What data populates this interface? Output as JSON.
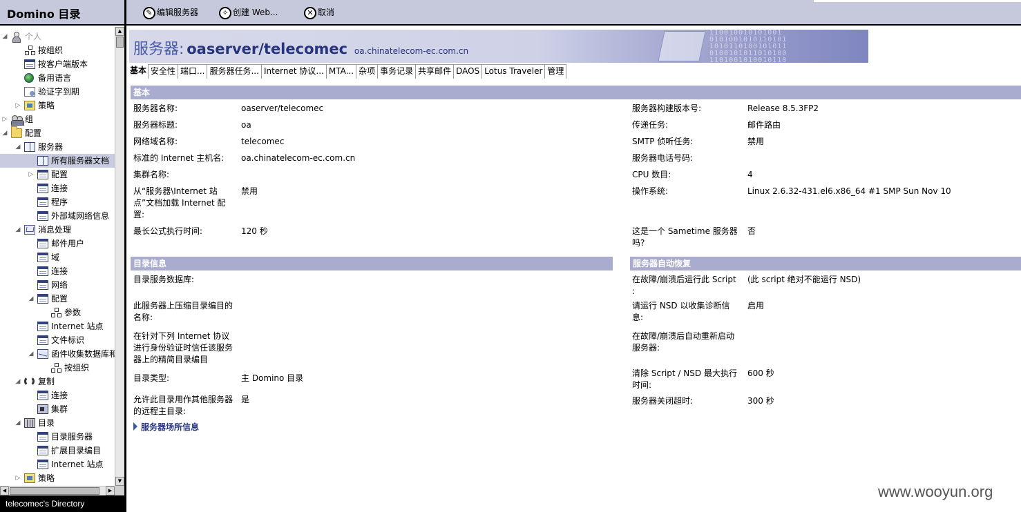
{
  "left_pane": {
    "title": "Domino 目录",
    "status": "telecomec's Directory"
  },
  "tree": [
    {
      "label": "个人",
      "icon": "person-icon",
      "level": 0,
      "twisty": "open",
      "muted": true
    },
    {
      "label": "按组织",
      "icon": "org-tree-icon",
      "level": 1,
      "twisty": "none"
    },
    {
      "label": "按客户端版本",
      "icon": "document-view-icon",
      "level": 1,
      "twisty": "none"
    },
    {
      "label": "备用语言",
      "icon": "globe-icon",
      "level": 1,
      "twisty": "none"
    },
    {
      "label": "验证字到期",
      "icon": "certificate-icon",
      "level": 1,
      "twisty": "none"
    },
    {
      "label": "策略",
      "icon": "policy-icon",
      "level": 1,
      "twisty": "closed"
    },
    {
      "label": "组",
      "icon": "group-icon",
      "level": 0,
      "twisty": "closed"
    },
    {
      "label": "配置",
      "icon": "folder-icon",
      "level": 0,
      "twisty": "open"
    },
    {
      "label": "服务器",
      "icon": "book-icon",
      "level": 1,
      "twisty": "open"
    },
    {
      "label": "所有服务器文档",
      "icon": "book-icon",
      "level": 2,
      "twisty": "none",
      "selected": true
    },
    {
      "label": "配置",
      "icon": "document-view-icon",
      "level": 2,
      "twisty": "closed"
    },
    {
      "label": "连接",
      "icon": "document-view-icon",
      "level": 2,
      "twisty": "none"
    },
    {
      "label": "程序",
      "icon": "document-view-icon",
      "level": 2,
      "twisty": "none"
    },
    {
      "label": "外部域网络信息",
      "icon": "document-view-icon",
      "level": 2,
      "twisty": "none"
    },
    {
      "label": "消息处理",
      "icon": "messaging-icon",
      "level": 1,
      "twisty": "open"
    },
    {
      "label": "邮件用户",
      "icon": "document-view-icon",
      "level": 2,
      "twisty": "none"
    },
    {
      "label": "域",
      "icon": "document-view-icon",
      "level": 2,
      "twisty": "none"
    },
    {
      "label": "连接",
      "icon": "document-view-icon",
      "level": 2,
      "twisty": "none"
    },
    {
      "label": "网络",
      "icon": "document-view-icon",
      "level": 2,
      "twisty": "none"
    },
    {
      "label": "配置",
      "icon": "document-view-icon",
      "level": 2,
      "twisty": "open"
    },
    {
      "label": "参数",
      "icon": "org-tree-icon",
      "level": 3,
      "twisty": "none"
    },
    {
      "label": "Internet 站点",
      "icon": "document-view-icon",
      "level": 2,
      "twisty": "none"
    },
    {
      "label": "文件标识",
      "icon": "document-view-icon",
      "level": 2,
      "twisty": "none"
    },
    {
      "label": "函件收集数据库和",
      "icon": "mail-icon",
      "level": 2,
      "twisty": "open"
    },
    {
      "label": "按组织",
      "icon": "org-tree-icon",
      "level": 3,
      "twisty": "none"
    },
    {
      "label": "复制",
      "icon": "sync-icon",
      "level": 1,
      "twisty": "open"
    },
    {
      "label": "连接",
      "icon": "document-view-icon",
      "level": 2,
      "twisty": "none"
    },
    {
      "label": "集群",
      "icon": "cluster-icon",
      "level": 2,
      "twisty": "none"
    },
    {
      "label": "目录",
      "icon": "directory-icon",
      "level": 1,
      "twisty": "open"
    },
    {
      "label": "目录服务器",
      "icon": "document-view-icon",
      "level": 2,
      "twisty": "none"
    },
    {
      "label": "扩展目录编目",
      "icon": "document-view-icon",
      "level": 2,
      "twisty": "none"
    },
    {
      "label": "Internet 站点",
      "icon": "document-view-icon",
      "level": 2,
      "twisty": "none"
    },
    {
      "label": "策略",
      "icon": "policy-icon",
      "level": 1,
      "twisty": "closed"
    }
  ],
  "actions": [
    {
      "label": "编辑服务器",
      "icon": "edit-icon"
    },
    {
      "label": "创建 Web...",
      "icon": "create-web-icon"
    },
    {
      "label": "取消",
      "icon": "cancel-icon"
    }
  ],
  "banner": {
    "label": "服务器:",
    "server": "oaserver/telecomec",
    "host": "oa.chinatelecom-ec.com.cn",
    "deco_binary": "110010010101001\n0101001010110101\n1010110100101011\n0100101011010100\n1101001010010110"
  },
  "tabs": [
    "基本",
    "安全性",
    "端口...",
    "服务器任务...",
    "Internet 协议...",
    "MTA...",
    "杂项",
    "事务记录",
    "共享邮件",
    "DAOS",
    "Lotus Traveler",
    "管理"
  ],
  "sections": {
    "basic": "基本",
    "directory": "目录信息",
    "recovery": "服务器自动恢复"
  },
  "basic_left": [
    {
      "label": "服务器名称:",
      "value": "oaserver/telecomec"
    },
    {
      "label": "服务器标题:",
      "value": "oa"
    },
    {
      "label": "网络域名称:",
      "value": "telecomec"
    },
    {
      "label": "标准的 Internet 主机名:",
      "value": "oa.chinatelecom-ec.com.cn"
    },
    {
      "label": "集群名称:",
      "value": ""
    },
    {
      "label": "从“服务器\\Internet 站点”文档加载 Internet 配置:",
      "value": "禁用"
    },
    {
      "label": "最长公式执行时间:",
      "value": "120 秒"
    }
  ],
  "basic_right": [
    {
      "label": "服务器构建版本号:",
      "value": "Release 8.5.3FP2"
    },
    {
      "label": "传递任务:",
      "value": "邮件路由"
    },
    {
      "label": "SMTP 侦听任务:",
      "value": "禁用"
    },
    {
      "label": "服务器电话号码:",
      "value": ""
    },
    {
      "label": "CPU 数目:",
      "value": "4"
    },
    {
      "label": "操作系统:",
      "value": "Linux 2.6.32-431.el6.x86_64 #1 SMP Sun Nov 10"
    },
    {
      "label": "这是一个 Sametime 服务器吗?",
      "value": "否"
    }
  ],
  "directory_fields": [
    {
      "label": "目录服务数据库:",
      "value": ""
    },
    {
      "label": "此服务器上压缩目录编目的名称:",
      "value": ""
    },
    {
      "label": "在针对下列 Internet 协议进行身份验证时信任该服务器上的精简目录编目",
      "value": ""
    },
    {
      "label": "目录类型:",
      "value": "主 Domino 目录"
    },
    {
      "label": "允许此目录用作其他服务器的远程主目录:",
      "value": "是"
    }
  ],
  "recovery_fields": [
    {
      "label": "在故障/崩溃后运行此 Script :",
      "value": "(此 script 绝对不能运行 NSD)"
    },
    {
      "label": "请运行 NSD 以收集诊断信息:",
      "value": "启用"
    },
    {
      "label": "在故障/崩溃后自动重新启动服务器:",
      "value": ""
    },
    {
      "label": "清除 Script / NSD 最大执行时间:",
      "value": "600 秒"
    },
    {
      "label": "服务器关闭超时:",
      "value": "300 秒"
    }
  ],
  "more_link": "服务器场所信息",
  "watermark": "www.wooyun.org",
  "colors": {
    "header_bg": "#c6c8dc",
    "section_bg": "#a9acce",
    "selection_bg": "#c9cce0",
    "title_blue": "#26347f"
  }
}
